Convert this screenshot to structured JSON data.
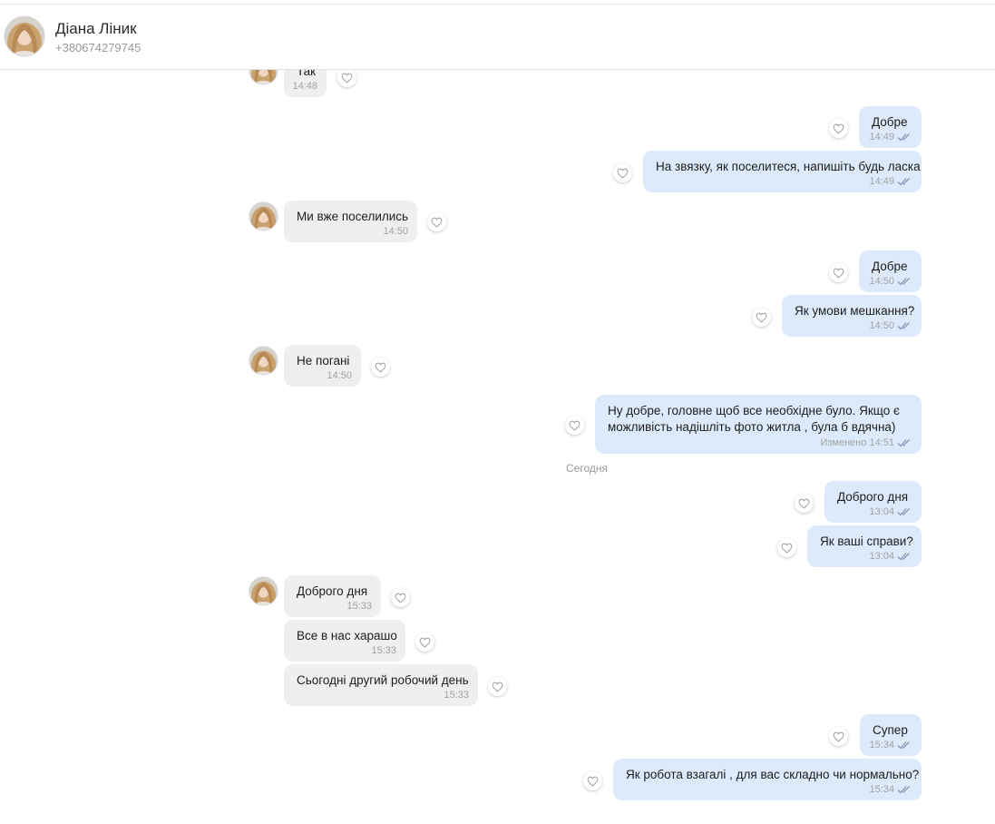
{
  "contact": {
    "name": "Діана Лiник",
    "phone": "+380674279745"
  },
  "day_separator": "Сегодня",
  "messages": [
    {
      "dir": "in",
      "text": "Так",
      "time": "14:48"
    },
    {
      "dir": "out",
      "text": "Добре",
      "time": "14:49"
    },
    {
      "dir": "out",
      "text": "На звязку, як поселитеся, напишіть будь ласка",
      "time": "14:49"
    },
    {
      "dir": "in",
      "text": "Ми вже поселились",
      "time": "14:50"
    },
    {
      "dir": "out",
      "text": "Добре",
      "time": "14:50"
    },
    {
      "dir": "out",
      "text": "Як умови мешкання?",
      "time": "14:50"
    },
    {
      "dir": "in",
      "text": "Не погані",
      "time": "14:50"
    },
    {
      "dir": "out",
      "text_line1": "Ну добре, головне щоб все необхідне було. Якщо є",
      "text_line2": "можливість надішліть фото житла , була б вдячна)",
      "edited": "Изменено",
      "time": "14:51"
    },
    {
      "dir": "out",
      "text": "Доброго дня",
      "time": "13:04"
    },
    {
      "dir": "out",
      "text": "Як ваші справи?",
      "time": "13:04"
    },
    {
      "dir": "in",
      "text": "Доброго дня",
      "time": "15:33"
    },
    {
      "dir": "in",
      "text": "Все в нас харашо",
      "time": "15:33"
    },
    {
      "dir": "in",
      "text": "Сьогодні другий робочий день",
      "time": "15:33"
    },
    {
      "dir": "out",
      "text": "Супер",
      "time": "15:34"
    },
    {
      "dir": "out",
      "text": "Як робота взагалі , для вас складно чи нормально?",
      "time": "15:34"
    }
  ],
  "icons": {
    "heart": "heart-icon",
    "read": "double-check-icon"
  },
  "colors": {
    "incoming_bubble": "#efefef",
    "outgoing_bubble": "#ddeafb",
    "read_ticks": "#8a96b8"
  }
}
